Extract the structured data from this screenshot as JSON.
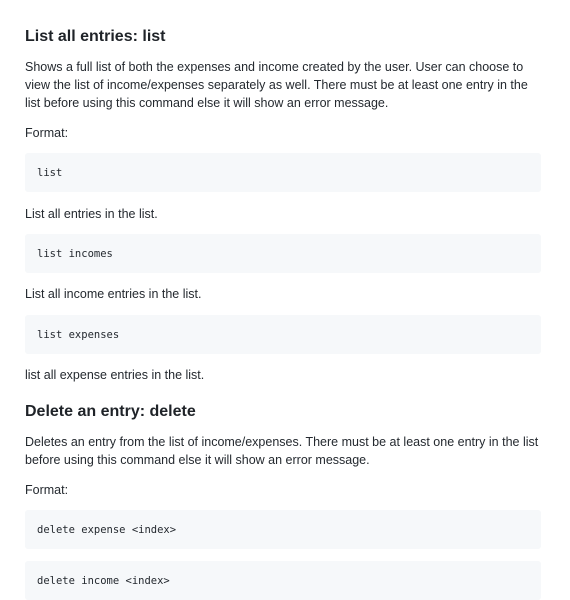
{
  "sections": [
    {
      "heading": "List all entries: list",
      "description": "Shows a full list of both the expenses and income created by the user. User can choose to view the list of income/expenses separately as well. There must be at least one entry in the list before using this command else it will show an error message.",
      "format_label": "Format:",
      "examples": [
        {
          "code": "list",
          "caption": "List all entries in the list."
        },
        {
          "code": "list incomes",
          "caption": "List all income entries in the list."
        },
        {
          "code": "list expenses",
          "caption": "list all expense entries in the list."
        }
      ]
    },
    {
      "heading": "Delete an entry: delete",
      "description": "Deletes an entry from the list of income/expenses. There must be at least one entry in the list before using this command else it will show an error message.",
      "format_label": "Format:",
      "examples": [
        {
          "code": "delete expense <index>"
        },
        {
          "code": "delete income <index>"
        }
      ]
    }
  ]
}
